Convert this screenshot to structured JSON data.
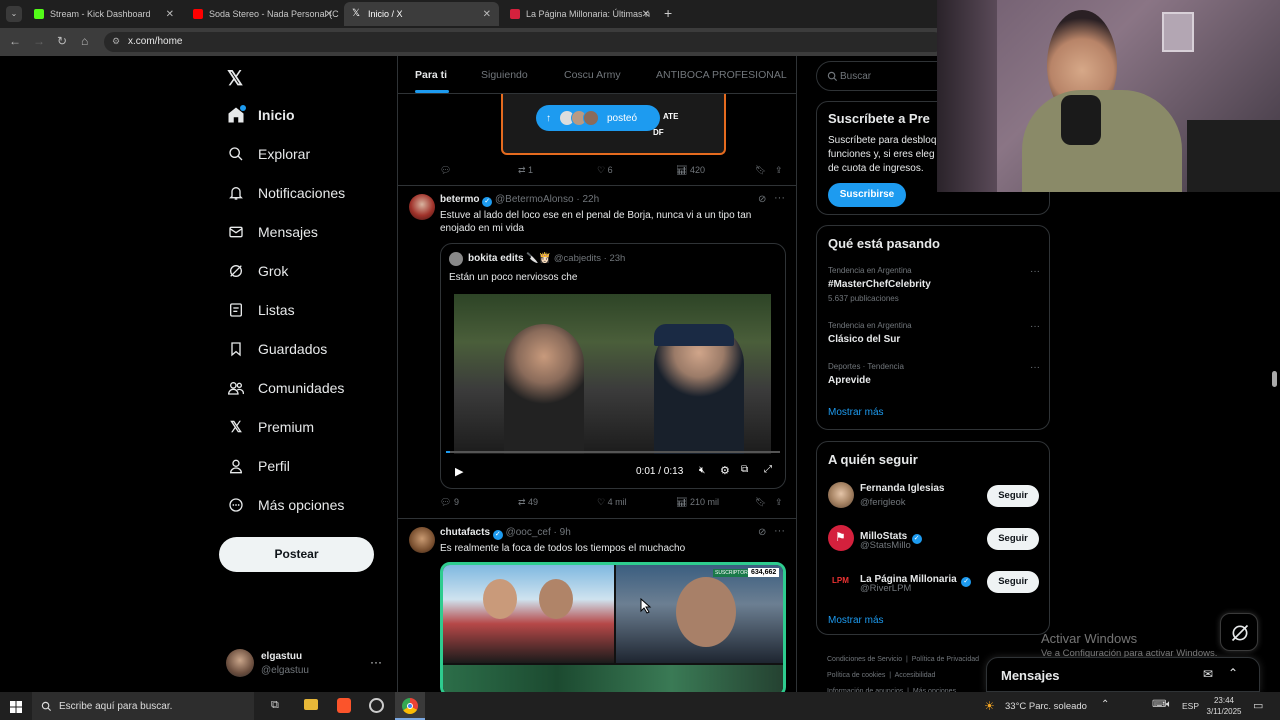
{
  "browser": {
    "tabs": [
      {
        "label": "Stream - Kick Dashboard",
        "color": "#53fc18"
      },
      {
        "label": "Soda Stereo - Nada Personal (C",
        "color": "#ff0000"
      },
      {
        "label": "Inicio / X",
        "color": "#ffffff"
      },
      {
        "label": "La Página Millonaria: Últimas n",
        "color": "#d4213d"
      }
    ],
    "url": "x.com/home"
  },
  "nav": {
    "items": [
      {
        "label": "Inicio",
        "icon": "home-icon"
      },
      {
        "label": "Explorar",
        "icon": "search-icon"
      },
      {
        "label": "Notificaciones",
        "icon": "bell-icon"
      },
      {
        "label": "Mensajes",
        "icon": "mail-icon"
      },
      {
        "label": "Grok",
        "icon": "grok-icon"
      },
      {
        "label": "Listas",
        "icon": "list-icon"
      },
      {
        "label": "Guardados",
        "icon": "bookmark-icon"
      },
      {
        "label": "Comunidades",
        "icon": "people-icon"
      },
      {
        "label": "Premium",
        "icon": "x-icon"
      },
      {
        "label": "Perfil",
        "icon": "person-icon"
      },
      {
        "label": "Más opciones",
        "icon": "more-circle-icon"
      }
    ],
    "post_label": "Postear",
    "account": {
      "name": "elgastuu",
      "handle": "@elgastuu"
    }
  },
  "timeline": {
    "tabs": [
      "Para ti",
      "Siguiendo",
      "Coscu Army",
      "ANTIBOCA PROFESIONAL"
    ],
    "new_posts_label": "posteó",
    "first_actions": {
      "replies": "",
      "reposts": "1",
      "likes": "6",
      "views": "420"
    },
    "tweet1": {
      "name": "betermo",
      "handle": "@BetermoAlonso",
      "time": "22h",
      "text": "Estuve al lado del loco ese en el penal de Borja, nunca vi a un tipo tan enojado en mi vida",
      "quote": {
        "name": "bokita edits 🔪👸🏻",
        "handle": "@cabjedits",
        "time": "23h",
        "text": "Están un poco nerviosos che"
      },
      "video_time": "0:01 / 0:13",
      "actions": {
        "replies": "9",
        "reposts": "49",
        "likes": "4 mil",
        "views": "210 mil"
      }
    },
    "tweet2": {
      "name": "chutafacts",
      "handle": "@ooc_cef",
      "time": "9h",
      "text": "Es realmente la foca de todos los tiempos el muchacho",
      "image_badge": "634,662",
      "image_tag": "SUSCRIPTORES"
    }
  },
  "sidebar": {
    "search_placeholder": "Buscar",
    "premium": {
      "title": "Suscríbete a Pre",
      "text1": "Suscríbete para desbloq",
      "text2": "funciones y, si eres eleg",
      "text3": "de cuota de ingresos.",
      "button": "Suscribirse"
    },
    "trends": {
      "title": "Qué está pasando",
      "items": [
        {
          "meta": "Tendencia en Argentina",
          "name": "#MasterChefCelebrity",
          "count": "5.637 publicaciones"
        },
        {
          "meta": "Tendencia en Argentina",
          "name": "Clásico del Sur",
          "count": ""
        },
        {
          "meta": "Deportes · Tendencia",
          "name": "Aprevide",
          "count": ""
        }
      ],
      "more": "Mostrar más"
    },
    "follow": {
      "title": "A quién seguir",
      "items": [
        {
          "name": "Fernanda Iglesias",
          "handle": "@ferigleok",
          "verified": false,
          "button": "Seguir"
        },
        {
          "name": "MilloStats",
          "handle": "@StatsMillo",
          "verified": true,
          "button": "Seguir"
        },
        {
          "name": "La Página Millonaria",
          "handle": "@RiverLPM",
          "verified": true,
          "button": "Seguir"
        }
      ],
      "more": "Mostrar más"
    },
    "footer": {
      "l1a": "Condiciones de Servicio",
      "l1b": "Política de Privacidad",
      "l2a": "Política de cookies",
      "l2b": "Accesibilidad",
      "l3a": "Información de anuncios",
      "l3b": "Más opciones ..."
    }
  },
  "messages": {
    "title": "Mensajes"
  },
  "watermark": {
    "line1": "Activar Windows",
    "line2": "Ve a Configuración para activar Windows."
  },
  "taskbar": {
    "search_placeholder": "Escribe aquí para buscar.",
    "weather": "33°C  Parc. soleado",
    "lang": "ESP",
    "time": "23:44",
    "date": "3/11/2025"
  }
}
